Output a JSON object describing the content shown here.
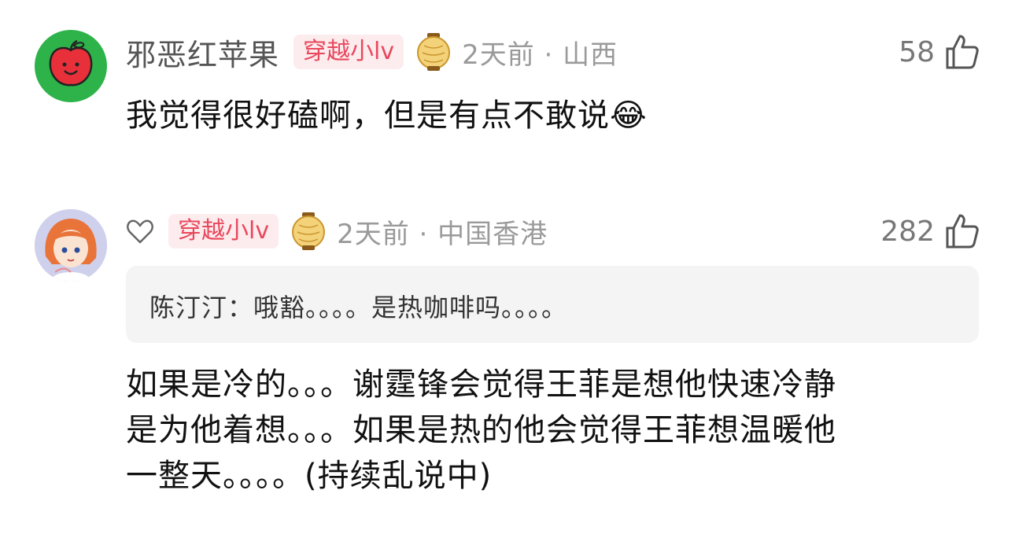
{
  "comments": [
    {
      "username": "邪恶红苹果",
      "badge": "穿越小lv",
      "meta": "2天前 · 山西",
      "likes": "58",
      "text": "我觉得很好磕啊，但是有点不敢说",
      "emoji": "😂",
      "avatar_icon": "apple-face-icon",
      "accent": "#2db34a"
    },
    {
      "badge": "穿越小lv",
      "meta": "2天前 · 中国香港",
      "likes": "282",
      "quote": "陈汀汀：哦豁。。。。是热咖啡吗。。。。",
      "lines": [
        "如果是冷的。。。谢霆锋会觉得王菲是想他快速冷静",
        "是为他着想。。。如果是热的他会觉得王菲想温暖他",
        "一整天。。。。(持续乱说中)"
      ],
      "avatar_icon": "anime-girl-avatar-icon"
    }
  ],
  "colors": {
    "badge_text": "#e8485d",
    "badge_bg": "#fdecee",
    "meta_gray": "#9a9a9a"
  }
}
